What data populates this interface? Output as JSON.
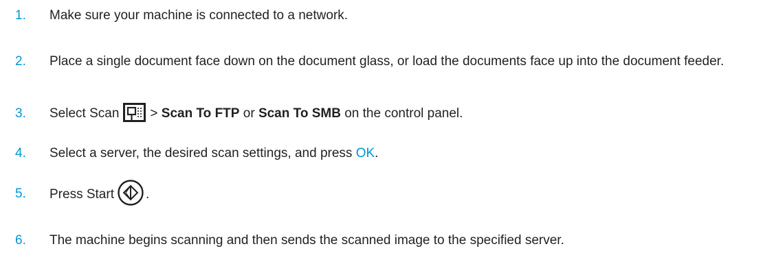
{
  "steps": [
    {
      "number": "1.",
      "text": "Make sure your machine is connected to a network."
    },
    {
      "number": "2.",
      "text": "Place a single document face down on the document glass, or load the documents face up into the document feeder."
    },
    {
      "number": "3.",
      "before_icon": "Select Scan",
      "icon": "scan-icon",
      "separator": ">",
      "option_ftp": "Scan To FTP",
      "or": "or",
      "option_smb": "Scan To SMB",
      "after": "on the control panel."
    },
    {
      "number": "4.",
      "before": "Select a server, the desired scan settings, and press",
      "ok": "OK",
      "after": "."
    },
    {
      "number": "5.",
      "before": "Press Start",
      "icon": "start-icon",
      "after": "."
    },
    {
      "number": "6.",
      "text": "The machine begins scanning and then sends the scanned image to the specified server."
    }
  ],
  "colors": {
    "accent": "#0096d6",
    "text": "#231f20"
  }
}
